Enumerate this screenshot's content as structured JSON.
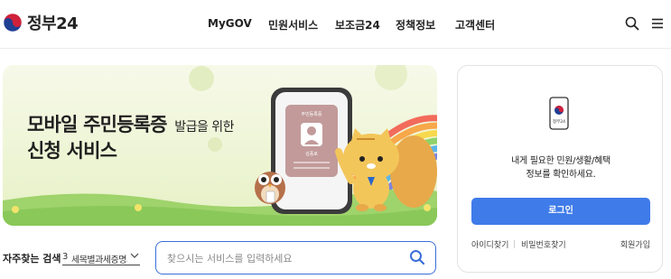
{
  "header": {
    "logo_text": "정부24",
    "nav": [
      "MyGOV",
      "민원서비스",
      "보조금24",
      "정책정보",
      "고객센터"
    ],
    "icons": [
      "search-icon",
      "menu-icon"
    ]
  },
  "banner": {
    "title_line1": "모바일 주민등록증",
    "title_line1_suffix": "발급을 위한",
    "title_line2": "신청 서비스",
    "card_label": "주민등록증",
    "card_name": "김풍로"
  },
  "search": {
    "faq_label": "자주찾는 검색",
    "faq_selected_num": "3",
    "faq_selected_text": "세목별과세증명서",
    "placeholder": "찾으시는 서비스를 입력하세요"
  },
  "login_card": {
    "phone_text": "정부24",
    "message_line1": "내게 필요한 민원/생활/혜택",
    "message_line2": "정보를 확인하세요.",
    "login_button": "로그인",
    "find_id": "아이디찾기",
    "find_password": "비밀번호찾기",
    "signup": "회원가입"
  },
  "colors": {
    "accent": "#3f7be9",
    "search_border": "#3a6fd8",
    "banner_bg": "#eef5d6",
    "emblem_red": "#d0213a",
    "emblem_blue": "#1f3f93"
  }
}
